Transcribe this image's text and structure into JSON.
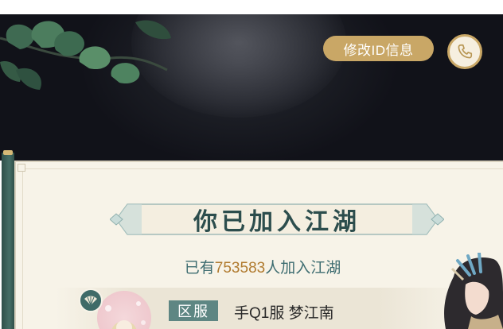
{
  "header": {
    "edit_id_label": "修改ID信息",
    "phone_icon": "phone-icon"
  },
  "panel": {
    "title": "你已加入江湖",
    "joined_prefix": "已有",
    "joined_count": "753583",
    "joined_suffix": "人加入江湖",
    "region_tag": "区服",
    "server_name": "手Q1服 梦江南"
  },
  "colors": {
    "gold": "#c9a766",
    "teal": "#5e8683",
    "title": "#2c4d4d",
    "count": "#b07a2e",
    "panel_bg": "#f7f3e8"
  }
}
